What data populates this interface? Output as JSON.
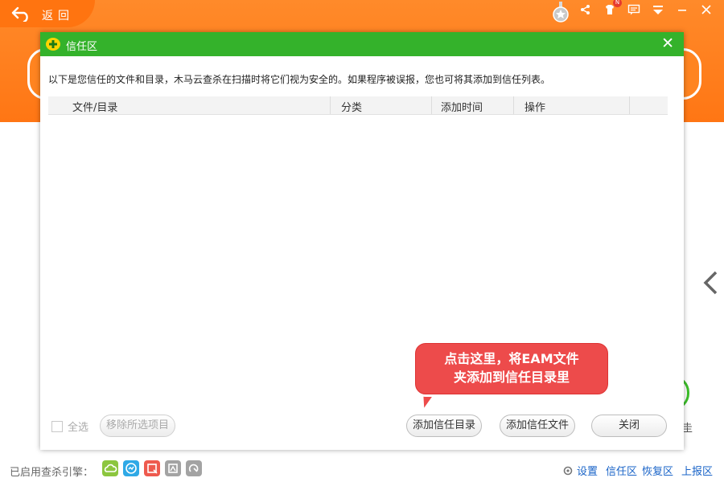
{
  "header": {
    "back_label": "返回",
    "badge": "N"
  },
  "dialog": {
    "title": "信任区",
    "description": "以下是您信任的文件和目录，木马云查杀在扫描时将它们视为安全的。如果程序被误报，您也可将其添加到信任列表。",
    "columns": [
      "文件/目录",
      "分类",
      "添加时间",
      "操作"
    ],
    "callout_line1": "点击这里，将EAM文件",
    "callout_line2": "夹添加到信任目录里",
    "select_all": "全选",
    "remove_selected": "移除所选项目",
    "add_trust_dir": "添加信任目录",
    "add_trust_file": "添加信任文件",
    "close": "关闭"
  },
  "footer": {
    "engines_label": "已启用查杀引擎：",
    "links": [
      "设置",
      "信任区",
      "恢复区",
      "上报区"
    ],
    "engine_colors": [
      "#8cc63f",
      "#2fa9e6",
      "#ee5a4e",
      "#a3a3a3",
      "#a3a3a3"
    ]
  },
  "colors": {
    "header": "#ff7a17",
    "dialog_title": "#34b22b",
    "callout": "#ed4b4b",
    "link": "#1a64c8"
  }
}
